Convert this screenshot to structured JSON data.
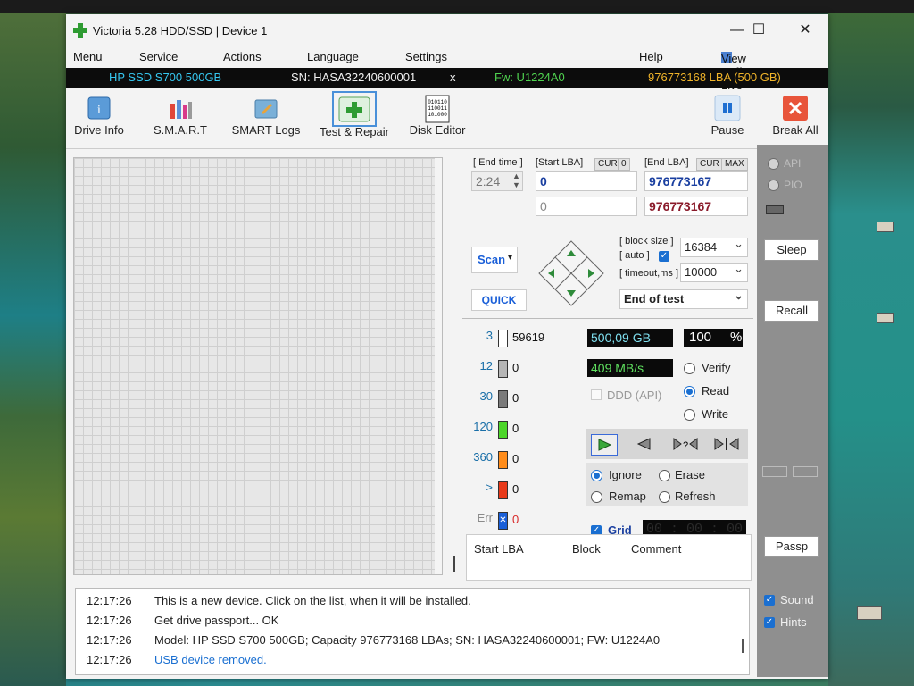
{
  "window": {
    "title": "Victoria 5.28 HDD/SSD | Device 1",
    "minimize": "—",
    "maximize": "☐",
    "close": "✕"
  },
  "menu": {
    "menu": "Menu",
    "service": "Service",
    "actions": "Actions",
    "language": "Language",
    "settings": "Settings",
    "help": "Help",
    "view_buffer": "View Buffer Live"
  },
  "device": {
    "model": "HP SSD S700 500GB",
    "sn": "SN: HASA32240600001",
    "close": "x",
    "fw": "Fw: U1224A0",
    "lba": "976773168 LBA (500 GB)"
  },
  "toolbar": {
    "drive_info": "Drive Info",
    "smart": "S.M.A.R.T",
    "smart_logs": "SMART Logs",
    "test_repair": "Test & Repair",
    "disk_editor": "Disk Editor",
    "pause": "Pause",
    "break_all": "Break All"
  },
  "params": {
    "end_time_label": "[ End time ]",
    "end_time": "2:24",
    "start_lba_label": "[Start LBA]",
    "cur": "CUR",
    "zero": "0",
    "end_lba_label": "[End LBA]",
    "max": "MAX",
    "start_lba": "0",
    "start_lba2": "0",
    "end_lba": "976773167",
    "end_lba2": "976773167",
    "block_size_label": "[ block size ]",
    "auto_label": "[ auto ]",
    "block_size": "16384",
    "timeout_label": "[ timeout,ms ]",
    "timeout": "10000",
    "end_action": "End of test",
    "scan": "Scan",
    "quick": "QUICK"
  },
  "stats": {
    "size": "500,09 GB",
    "percent": "100",
    "percent_unit": "%",
    "speed": "409 MB/s",
    "ddd": "DDD (API)",
    "verify": "Verify",
    "read": "Read",
    "write": "Write",
    "ignore": "Ignore",
    "erase": "Erase",
    "remap": "Remap",
    "refresh": "Refresh",
    "grid": "Grid",
    "timer": "00 : 00 : 00"
  },
  "blocks": [
    {
      "label": "3",
      "count": "59619",
      "color": "#ffffff"
    },
    {
      "label": "12",
      "count": "0",
      "color": "#b5b5b5"
    },
    {
      "label": "30",
      "count": "0",
      "color": "#7a7a7a"
    },
    {
      "label": "120",
      "count": "0",
      "color": "#4cd62a"
    },
    {
      "label": "360",
      "count": "0",
      "color": "#ff8c1a"
    },
    {
      "label": ">",
      "count": "0",
      "color": "#e83a1a"
    },
    {
      "label": "Err",
      "count": "0",
      "color": "#1a5fd8"
    }
  ],
  "table_headers": {
    "start_lba": "Start LBA",
    "block": "Block",
    "comment": "Comment"
  },
  "side": {
    "api": "API",
    "pio": "PIO",
    "sleep": "Sleep",
    "recall": "Recall",
    "passp": "Passp",
    "sound": "Sound",
    "hints": "Hints"
  },
  "log": [
    {
      "time": "12:17:26",
      "msg": "This is a new device. Click on the list, when it will be installed."
    },
    {
      "time": "12:17:26",
      "msg": "Get drive passport... OK"
    },
    {
      "time": "12:17:26",
      "msg": "Model: HP SSD S700 500GB; Capacity 976773168 LBAs; SN: HASA32240600001; FW: U1224A0"
    },
    {
      "time": "12:17:26",
      "msg": "USB device removed."
    }
  ]
}
